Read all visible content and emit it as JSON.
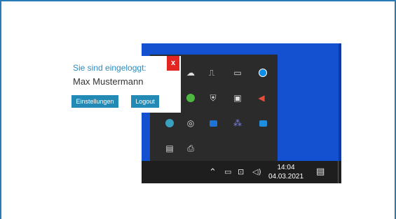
{
  "popup": {
    "status": "Sie sind eingeloggt:",
    "user_name": "Max Mustermann",
    "settings_label": "Einstellungen",
    "logout_label": "Logout",
    "close_label": "x"
  },
  "taskbar": {
    "time": "14:04",
    "date": "04.03.2021"
  },
  "tray_icons": [
    "nvidia-icon",
    "cloud-off-icon",
    "usb-icon",
    "monitor-icon",
    "teamviewer-icon",
    "green-app-icon",
    "sync-icon",
    "security-shield-icon",
    "display-icon",
    "speaker-icon",
    "globe-icon",
    "spiral-app-icon",
    "outlook-icon",
    "teams-icon",
    "screen-app-icon",
    "dropbox-icon",
    "printer-icon"
  ],
  "colors": {
    "accent": "#2389b5",
    "close": "#e32622",
    "desktop": "#1451d1",
    "tray": "#2b2b2b",
    "taskbar": "#1e1e1e"
  }
}
